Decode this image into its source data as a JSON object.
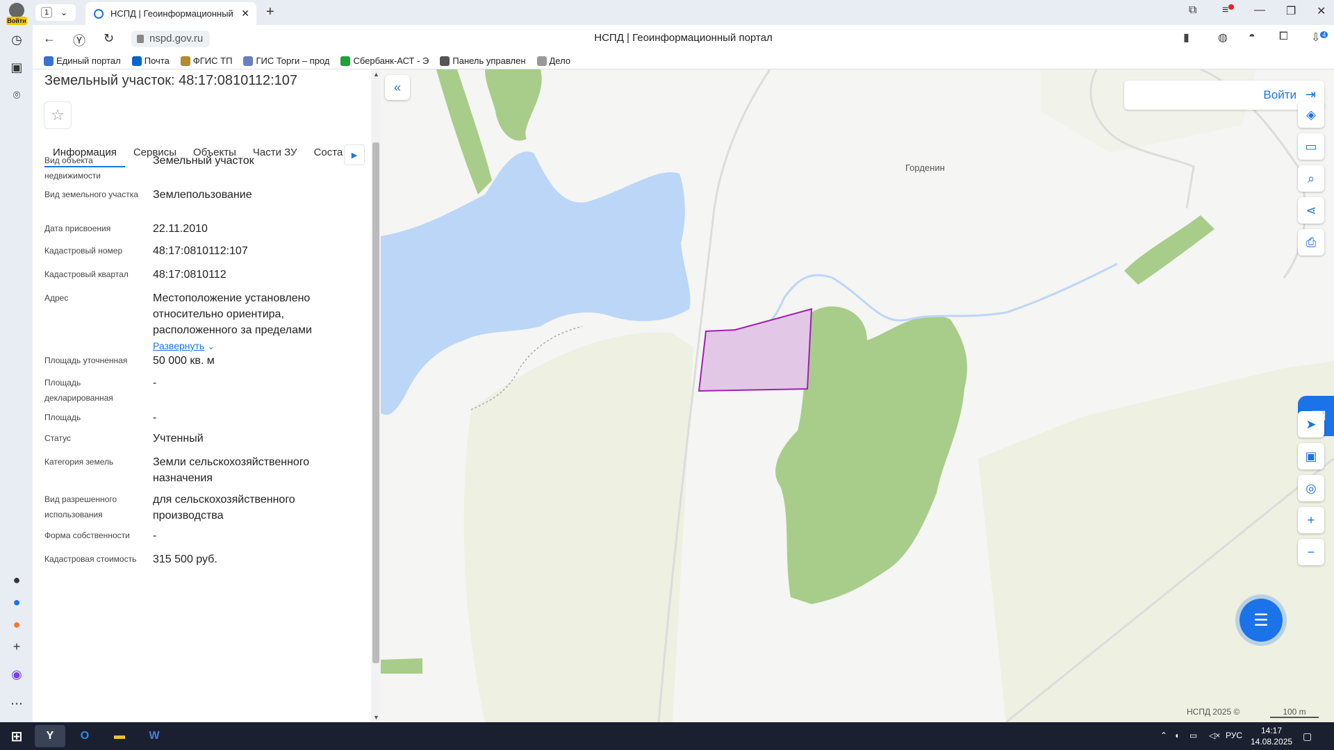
{
  "browser": {
    "profile_label": "Войти",
    "tab_count": "1",
    "tab_title": "НСПД | Геоинформационный портал",
    "url": "nspd.gov.ru",
    "page_title": "НСПД | Геоинформационный портал",
    "download_badge": "4",
    "bookmarks": [
      {
        "label": "Единый портал",
        "color": "#3b6fd4"
      },
      {
        "label": "Почта",
        "color": "#0a64c9"
      },
      {
        "label": "ФГИС ТП",
        "color": "#b58a2b"
      },
      {
        "label": "ГИС Торги – прод",
        "color": "#6a7fc2"
      },
      {
        "label": "Сбербанк-АСТ - Э",
        "color": "#21a038"
      },
      {
        "label": "Панель управлен",
        "color": "#555555"
      },
      {
        "label": "Дело",
        "color": "#999999"
      }
    ]
  },
  "panel": {
    "title": "Земельный участок: 48:17:0810112:107",
    "tabs": [
      "Информация",
      "Сервисы",
      "Объекты",
      "Части ЗУ",
      "Соста"
    ],
    "rows": [
      {
        "key": "Вид объекта недвижимости",
        "value": "Земельный участок"
      },
      {
        "key": "Вид земельного участка",
        "value": "Землепользование"
      },
      {
        "key": "Дата присвоения",
        "value": "22.11.2010"
      },
      {
        "key": "Кадастровый номер",
        "value": "48:17:0810112:107"
      },
      {
        "key": "Кадастровый квартал",
        "value": "48:17:0810112"
      },
      {
        "key": "Адрес",
        "value": "Местоположение установлено относительно ориентира, расположенного за пределами",
        "link": "Развернуть"
      },
      {
        "key": "Площадь уточненная",
        "value": "50 000 кв. м"
      },
      {
        "key": "Площадь декларированная",
        "value": "-"
      },
      {
        "key": "Площадь",
        "value": "-"
      },
      {
        "key": "Статус",
        "value": "Учтенный"
      },
      {
        "key": "Категория земель",
        "value": "Земли сельскохозяйственного назначения"
      },
      {
        "key": "Вид разрешенного использования",
        "value": "для сельскохозяйственного производства"
      },
      {
        "key": "Форма собственности",
        "value": "-"
      },
      {
        "key": "Кадастровая стоимость",
        "value": "315 500 руб."
      }
    ]
  },
  "map": {
    "login_label": "Войти",
    "place_name": "Горденин",
    "copyright": "НСПД 2025 ©",
    "scale_label": "100 m",
    "colors": {
      "water": "#bcd6f7",
      "forest": "#a8cd8a",
      "field": "#eef0e2",
      "parcel_fill": "#e2c8e6",
      "parcel_stroke": "#a020b0"
    }
  },
  "taskbar": {
    "language": "РУС",
    "time": "14:17",
    "date": "14.08.2025"
  }
}
